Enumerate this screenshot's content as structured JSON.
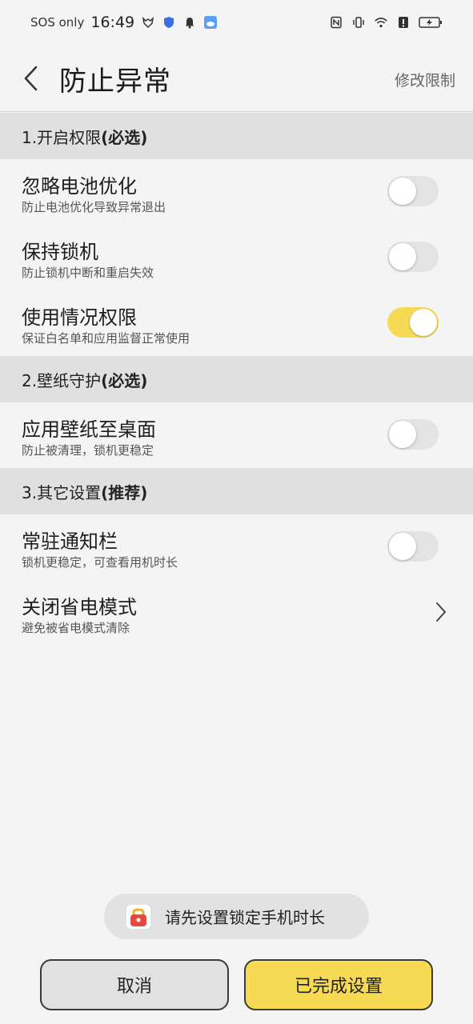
{
  "status_bar": {
    "carrier": "SOS only",
    "time": "16:49",
    "icons": [
      "fox-icon",
      "shield-icon",
      "bell-icon",
      "weather-icon",
      "nfc-icon",
      "vibrate-icon",
      "wifi-icon",
      "alert-icon",
      "battery-charging-icon"
    ]
  },
  "header": {
    "title": "防止异常",
    "action_label": "修改限制"
  },
  "sections": [
    {
      "label": "1.开启权限",
      "tag": "(必选)",
      "items": [
        {
          "title": "忽略电池优化",
          "subtitle": "防止电池优化导致异常退出",
          "control": "toggle",
          "on": false
        },
        {
          "title": "保持锁机",
          "subtitle": "防止锁机中断和重启失效",
          "control": "toggle",
          "on": false
        },
        {
          "title": "使用情况权限",
          "subtitle": "保证白名单和应用监督正常使用",
          "control": "toggle",
          "on": true
        }
      ]
    },
    {
      "label": "2.壁纸守护",
      "tag": "(必选)",
      "items": [
        {
          "title": "应用壁纸至桌面",
          "subtitle": "防止被清理，锁机更稳定",
          "control": "toggle",
          "on": false
        }
      ]
    },
    {
      "label": "3.其它设置",
      "tag": "(推荐)",
      "items": [
        {
          "title": "常驻通知栏",
          "subtitle": "锁机更稳定，可查看用机时长",
          "control": "toggle",
          "on": false
        },
        {
          "title": "关闭省电模式",
          "subtitle": "避免被省电模式清除",
          "control": "chevron"
        }
      ]
    }
  ],
  "toast": {
    "text": "请先设置锁定手机时长",
    "icon": "lock-icon"
  },
  "buttons": {
    "cancel_label": "取消",
    "done_label": "已完成设置"
  },
  "colors": {
    "accent": "#f7da54",
    "section_bg": "#e0e0e0",
    "page_bg": "#f4f4f4"
  }
}
